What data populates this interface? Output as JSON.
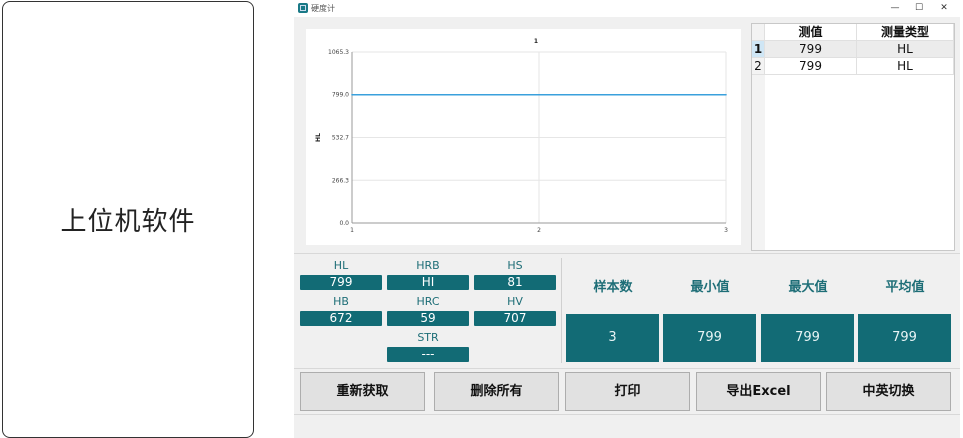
{
  "left_card": {
    "label": "上位机软件"
  },
  "window": {
    "title": "硬度计",
    "minimize": "—",
    "maximize": "☐",
    "close": "✕"
  },
  "chart_data": {
    "type": "line",
    "title": "1",
    "ylabel": "HL",
    "x": [
      1,
      2,
      3
    ],
    "x_ticks": [
      "1",
      "2",
      "3"
    ],
    "y_ticks": [
      "0.0",
      "266.3",
      "532.7",
      "799.0",
      "1065.3"
    ],
    "ylim": [
      0,
      1065.3
    ],
    "xlim": [
      1,
      3
    ],
    "series": [
      {
        "values": [
          799,
          799,
          799
        ]
      }
    ],
    "grid": true,
    "line_color": "#3aa0dc"
  },
  "table": {
    "headers": [
      "测值",
      "测量类型"
    ],
    "rows": [
      {
        "num": "1",
        "value": "799",
        "type": "HL"
      },
      {
        "num": "2",
        "value": "799",
        "type": "HL"
      }
    ]
  },
  "measures": [
    {
      "label": "HL",
      "value": "799"
    },
    {
      "label": "HRB",
      "value": "HI"
    },
    {
      "label": "HS",
      "value": "81"
    },
    {
      "label": "HB",
      "value": "672"
    },
    {
      "label": "HRC",
      "value": "59"
    },
    {
      "label": "HV",
      "value": "707"
    },
    {
      "label": "STR",
      "value": "---"
    }
  ],
  "stats": [
    {
      "label": "样本数",
      "value": "3"
    },
    {
      "label": "最小值",
      "value": "799"
    },
    {
      "label": "最大值",
      "value": "799"
    },
    {
      "label": "平均值",
      "value": "799"
    }
  ],
  "buttons": {
    "reacquire": "重新获取",
    "delete_all": "删除所有",
    "print": "打印",
    "export": "导出Excel",
    "lang": "中英切换"
  },
  "colors": {
    "accent": "#126b75",
    "label": "#1e6e77"
  }
}
